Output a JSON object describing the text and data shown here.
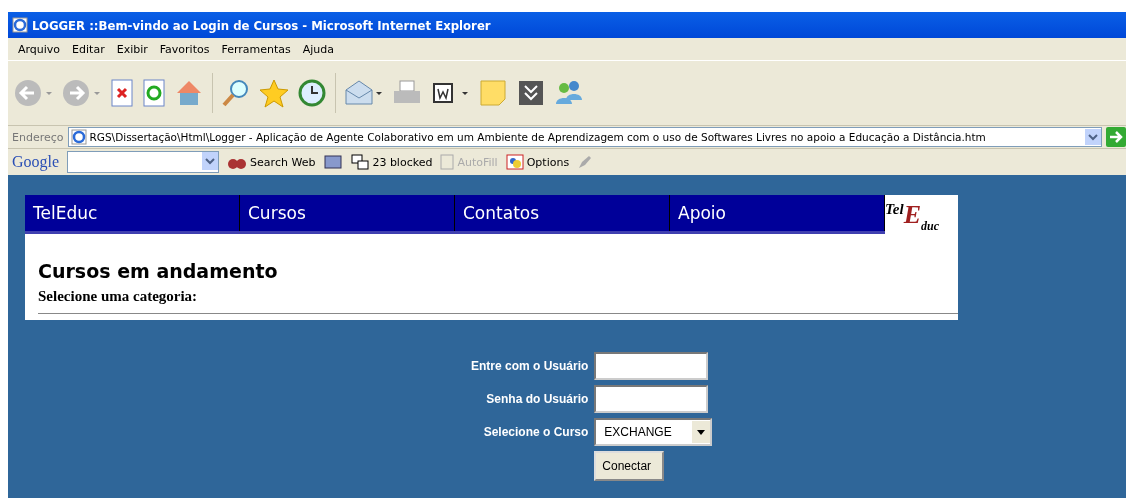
{
  "window": {
    "title": "LOGGER ::Bem-vindo ao Login de Cursos - Microsoft Internet Explorer"
  },
  "menu": [
    "Arquivo",
    "Editar",
    "Exibir",
    "Favoritos",
    "Ferramentas",
    "Ajuda"
  ],
  "toolbar": [
    {
      "kind": "back"
    },
    {
      "kind": "forward"
    },
    {
      "kind": "stop"
    },
    {
      "kind": "refresh"
    },
    {
      "kind": "home"
    },
    {
      "kind": "sep"
    },
    {
      "kind": "search"
    },
    {
      "kind": "star"
    },
    {
      "kind": "history"
    },
    {
      "kind": "sep"
    },
    {
      "kind": "mail"
    },
    {
      "kind": "print"
    },
    {
      "kind": "word"
    },
    {
      "kind": "note"
    },
    {
      "kind": "messenger"
    },
    {
      "kind": "people"
    }
  ],
  "address": {
    "label": "Endereço",
    "value": "RGS\\Dissertação\\Html\\Logger - Aplicação de Agente Colaborativo em um Ambiente de Aprendizagem com o uso de Softwares Livres no apoio a  Educação a Distância.htm"
  },
  "google_bar": {
    "brand": "Google",
    "search_web": "Search Web",
    "blocked": "23 blocked",
    "autofill": "AutoFill",
    "options": "Options"
  },
  "nav": [
    "TelEduc",
    "Cursos",
    "Contatos",
    "Apoio"
  ],
  "logo": {
    "part_1": "Tel",
    "part_2": "E",
    "part_3": "duc"
  },
  "panel": {
    "heading": "Cursos em andamento",
    "subheading": "Selecione uma categoria:"
  },
  "form": {
    "user_label": "Entre com o Usuário",
    "password_label": "Senha do Usuário",
    "course_label": "Selecione o Curso",
    "course_value": "EXCHANGE",
    "button": "Conectar"
  }
}
